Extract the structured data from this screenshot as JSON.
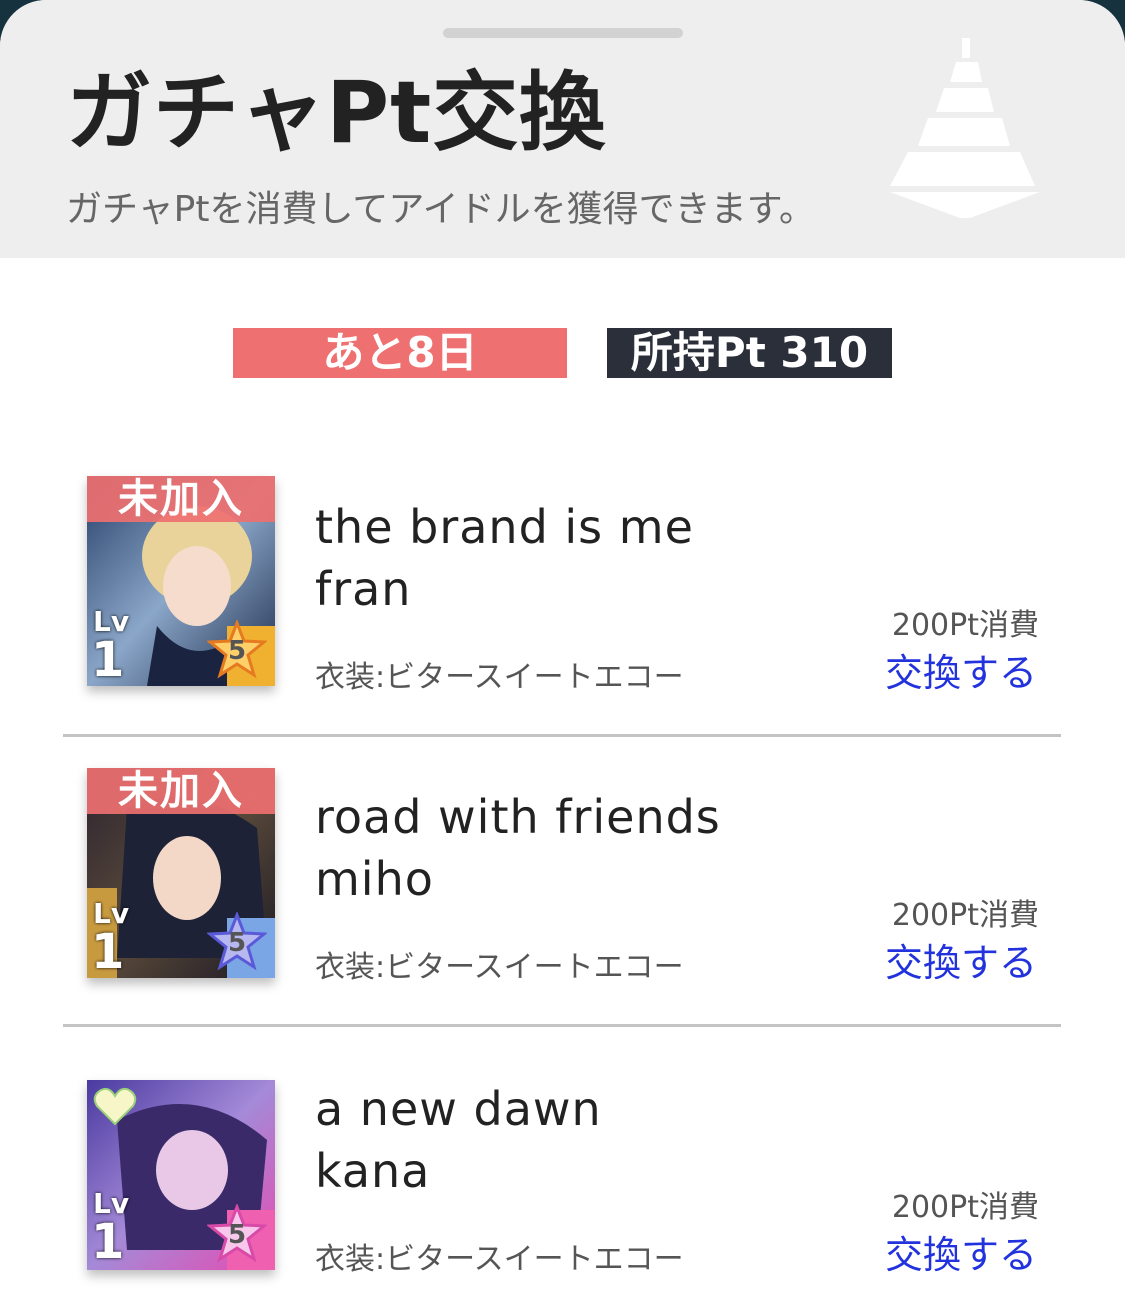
{
  "header": {
    "title": "ガチャPt交換",
    "subtitle": "ガチャPtを消費してアイドルを獲得できます。"
  },
  "status": {
    "days_left": "あと8日",
    "points_owned": "所持Pt 310",
    "days_color": "#ee7070",
    "points_color": "#2b2f3a"
  },
  "items": [
    {
      "ribbon": "未加入",
      "lv_label": "Lv",
      "level": "1",
      "rarity": "5",
      "name_line1": "the brand is me",
      "name_line2": "fran",
      "costume": "衣装:ビタースイートエコー",
      "cost": "200Pt消費",
      "action": "交換する",
      "icon": "star-rarity-icon"
    },
    {
      "ribbon": "未加入",
      "lv_label": "Lv",
      "level": "1",
      "rarity": "5",
      "name_line1": "road with friends",
      "name_line2": "miho",
      "costume": "衣装:ビタースイートエコー",
      "cost": "200Pt消費",
      "action": "交換する",
      "icon": "star-rarity-icon"
    },
    {
      "ribbon": "",
      "lv_label": "Lv",
      "level": "1",
      "rarity": "5",
      "name_line1": "a new dawn",
      "name_line2": "kana",
      "costume": "衣装:ビタースイートエコー",
      "cost": "200Pt消費",
      "action": "交換する",
      "icon": "heart-icon"
    }
  ],
  "colors": {
    "link": "#2233dd",
    "ribbon": "#ee7070",
    "header_bg": "#eeeeee"
  }
}
